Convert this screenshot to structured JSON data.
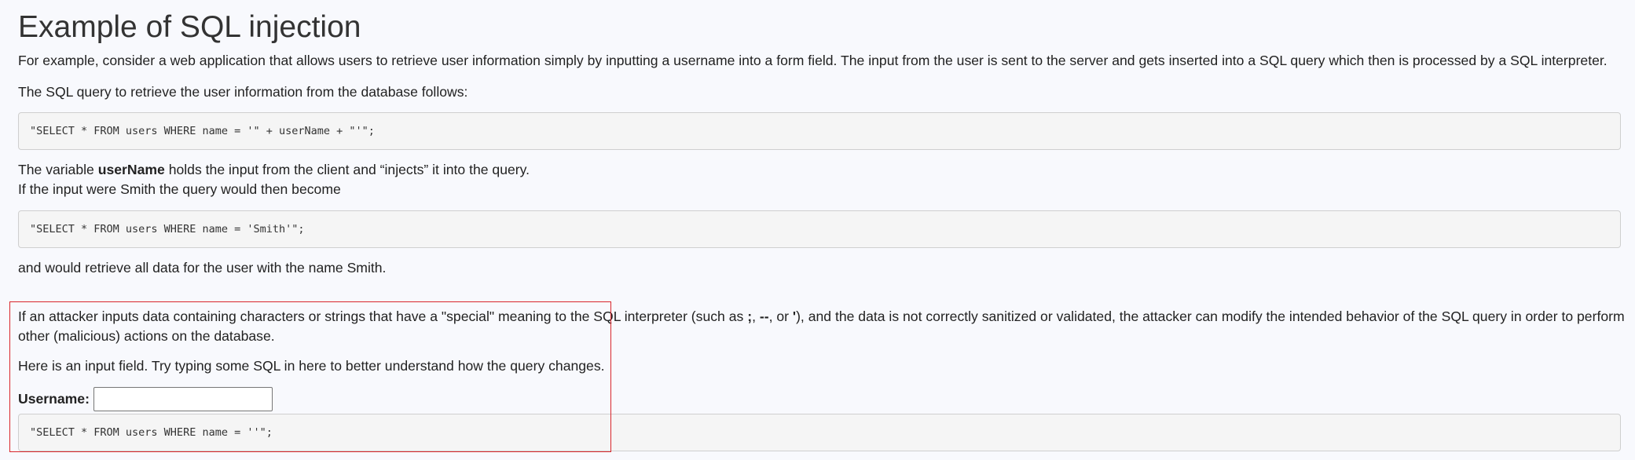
{
  "title": "Example of SQL injection",
  "intro": "For example, consider a web application that allows users to retrieve user information simply by inputting a username into a form field. The input from the user is sent to the server and gets inserted into a SQL query which then is processed by a SQL interpreter.",
  "query_intro": "The SQL query to retrieve the user information from the database follows:",
  "code_1": "\"SELECT * FROM users WHERE name = '\" + userName + \"'\";",
  "variable_text": {
    "prefix": "The variable ",
    "bold": "userName",
    "suffix": " holds the input from the client and “injects” it into the query."
  },
  "smith_intro": "If the input were Smith the query would then become",
  "code_2": "\"SELECT * FROM users WHERE name = 'Smith'\";",
  "smith_result": "and would retrieve all data for the user with the name Smith.",
  "attacker_text": {
    "part1": "If an attacker inputs data containing characters or strings that have a \"special\" meaning to the SQL interpreter (such as ",
    "sym1": ";",
    "sep1": ", ",
    "sym2": "--",
    "sep2": ", or ",
    "sym3": "'",
    "part2": "), and the data is not correctly sanitized or validated, the attacker can modify the intended behavior of the SQL query in order to perform",
    "line2": "other (malicious) actions on the database."
  },
  "input_intro": "Here is an input field. Try typing some SQL in here to better understand how the query changes.",
  "username": {
    "label": "Username:",
    "value": "",
    "placeholder": ""
  },
  "code_3": "\"SELECT * FROM users WHERE name = ''\";",
  "colors": {
    "highlight_border": "#d9262b",
    "code_background": "#f5f5f5",
    "page_background": "#f8f9fd"
  }
}
